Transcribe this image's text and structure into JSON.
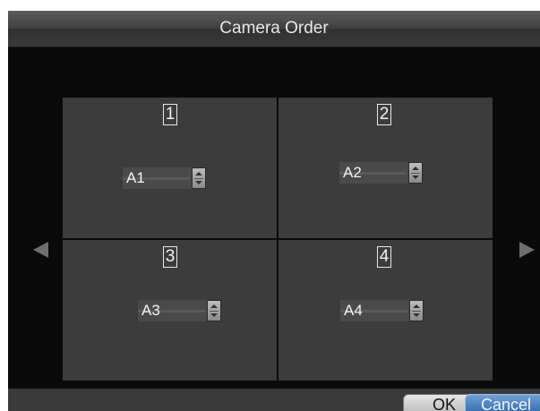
{
  "dialog": {
    "title": "Camera Order",
    "cells": [
      {
        "number": "1",
        "camera": "A1"
      },
      {
        "number": "2",
        "camera": "A2"
      },
      {
        "number": "3",
        "camera": "A3"
      },
      {
        "number": "4",
        "camera": "A4"
      }
    ],
    "nav": {
      "prev_icon": "triangle-left-icon",
      "next_icon": "triangle-right-icon"
    },
    "buttons": {
      "ok": "OK",
      "cancel": "Cancel"
    }
  }
}
